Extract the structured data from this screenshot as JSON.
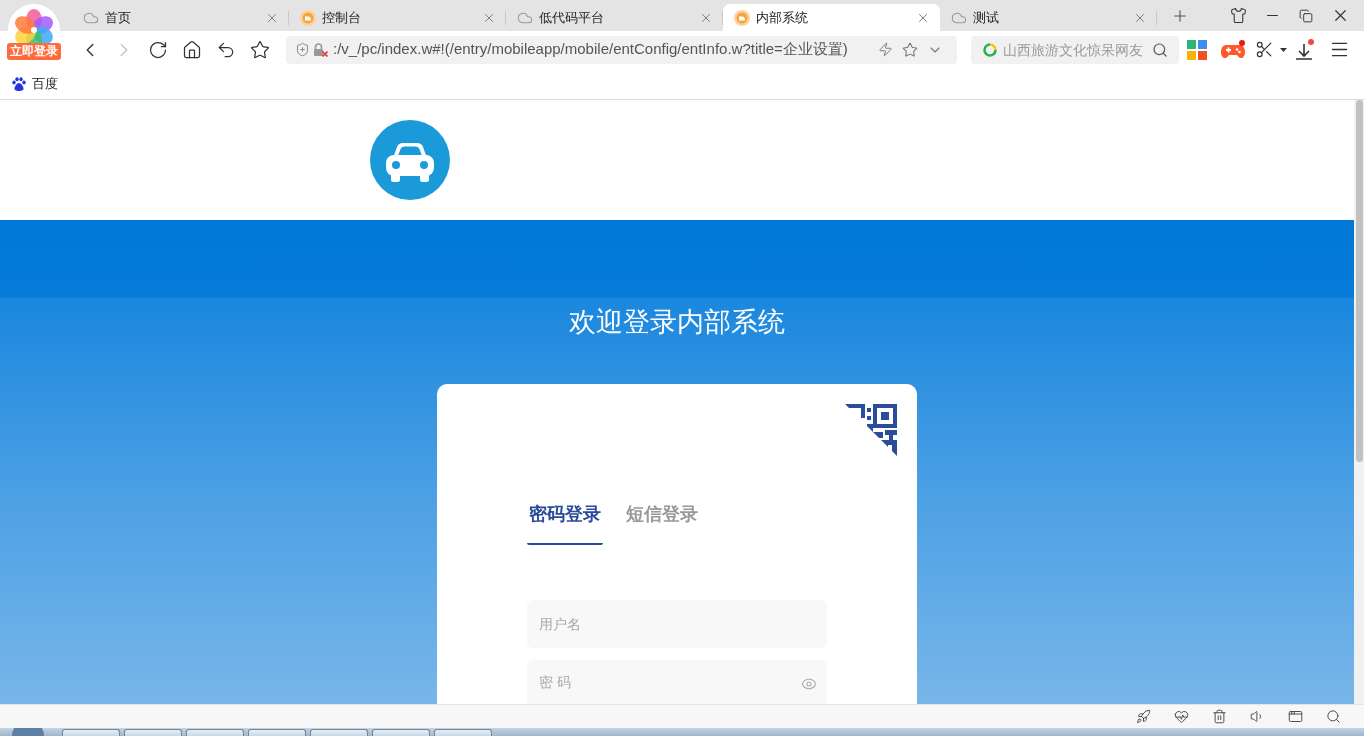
{
  "browser": {
    "login_badge": "立即登录",
    "tabs": [
      {
        "title": "首页",
        "kind": "cloud",
        "selected": false
      },
      {
        "title": "控制台",
        "kind": "app",
        "selected": false
      },
      {
        "title": "低代码平台",
        "kind": "cloud",
        "selected": false
      },
      {
        "title": "内部系统",
        "kind": "app",
        "selected": true
      },
      {
        "title": "测试",
        "kind": "cloud",
        "selected": false
      }
    ],
    "nav_buttons": [
      {
        "kind": "back",
        "disabled": false
      },
      {
        "kind": "forward",
        "disabled": true
      },
      {
        "kind": "reload",
        "disabled": false
      },
      {
        "kind": "home",
        "disabled": false
      },
      {
        "kind": "undo",
        "disabled": false
      },
      {
        "kind": "favorite",
        "disabled": false
      }
    ],
    "address": {
      "value": ":/v_/pc/index.w#!(/entry/mobileapp/mobile/entConfig/entInfo.w?title=企业设置)"
    },
    "search": {
      "placeholder": "山西旅游文化惊呆网友"
    },
    "bookmarks": [
      {
        "label": "百度"
      }
    ]
  },
  "page": {
    "title": "欢迎登录内部系统",
    "login_tabs": [
      {
        "label": "密码登录",
        "selected": true
      },
      {
        "label": "短信登录",
        "selected": false
      }
    ],
    "fields": [
      {
        "kind": "text",
        "placeholder": "用户名"
      },
      {
        "kind": "password",
        "placeholder": "密 码"
      }
    ]
  }
}
